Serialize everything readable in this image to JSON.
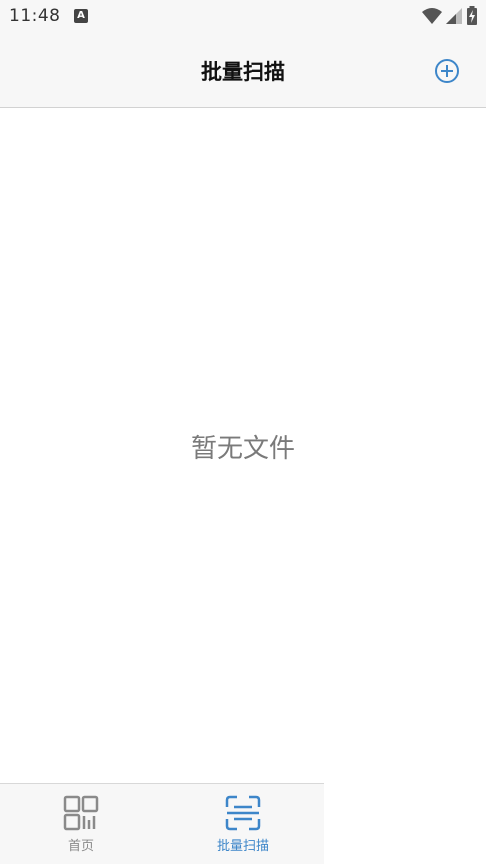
{
  "status_bar": {
    "time": "11:48",
    "notification_badge": "A",
    "icons": [
      "wifi-icon",
      "signal-icon",
      "battery-charging-icon"
    ]
  },
  "header": {
    "title": "批量扫描",
    "add_icon": "add-circle-icon",
    "accent_color": "#3d86c9"
  },
  "main": {
    "empty_text": "暂无文件"
  },
  "tabbar": {
    "tabs": [
      {
        "label": "首页",
        "icon": "qr-code-icon",
        "active": false
      },
      {
        "label": "批量扫描",
        "icon": "scan-icon",
        "active": true
      }
    ],
    "active_color": "#3d86c9",
    "inactive_color": "#8a8a8a"
  }
}
